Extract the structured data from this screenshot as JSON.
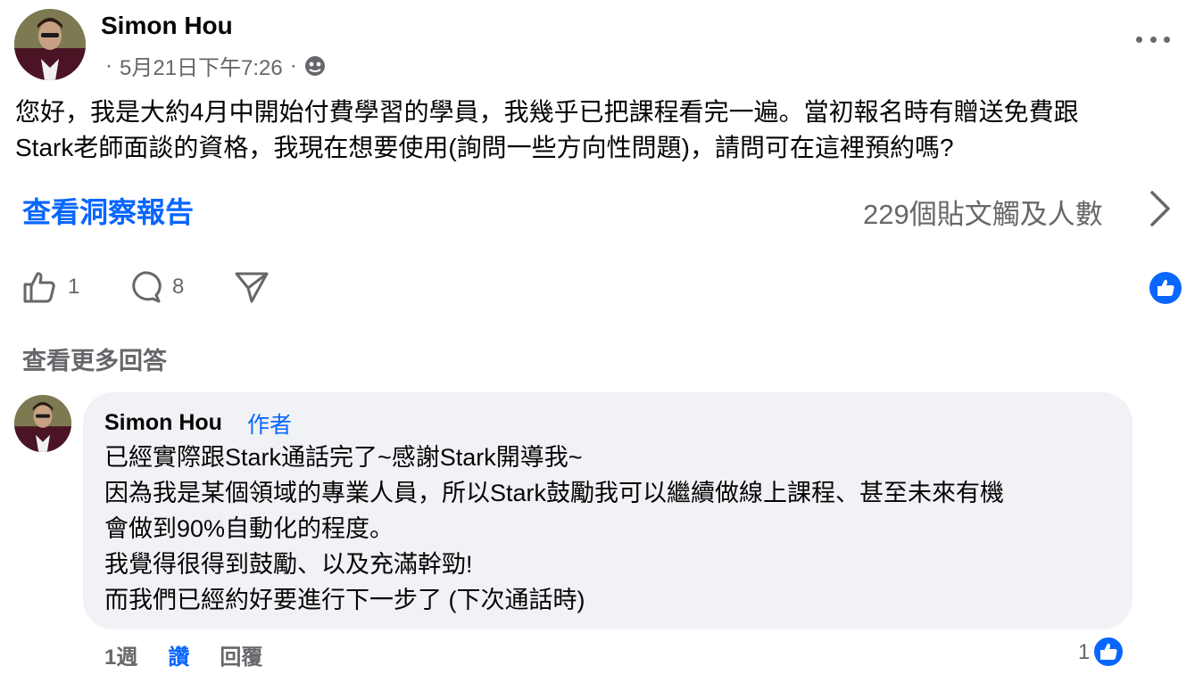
{
  "post": {
    "author": "Simon Hou",
    "date": "5月21日下午7:26",
    "meta_separator": "·",
    "audience_icon": "globe-icon",
    "body_line1": "您好，我是大約4月中開始付費學習的學員，我幾乎已把課程看完一遍。當初報名時有贈送免費跟",
    "body_line2": "Stark老師面談的資格，我現在想要使用(詢問一些方向性問題)，請問可在這裡預約嗎?",
    "insights_link": "查看洞察報告",
    "reach_text": "229個貼文觸及人數",
    "like_count": "1",
    "comment_count": "8"
  },
  "comments": {
    "see_more": "查看更多回答",
    "reply": {
      "author": "Simon Hou",
      "badge": "作者",
      "lines": [
        "已經實際跟Stark通話完了~感謝Stark開導我~",
        "因為我是某個領域的專業人員，所以Stark鼓勵我可以繼續做線上課程、甚至未來有機",
        "會做到90%自動化的程度。",
        "我覺得很得到鼓勵、以及充滿幹勁!",
        "而我們已經約好要進行下一步了 (下次通話時)"
      ],
      "time": "1週",
      "like_action": "讚",
      "reply_action": "回覆",
      "reaction_count": "1"
    }
  },
  "colors": {
    "accent": "#0866ff",
    "secondary_text": "#65676b",
    "bubble": "#f0f2f5"
  }
}
